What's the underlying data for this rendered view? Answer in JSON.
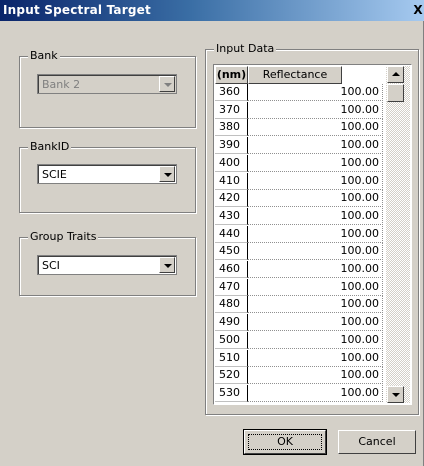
{
  "window": {
    "title": "Input Spectral Target",
    "close_glyph": "X"
  },
  "bank": {
    "legend": "Bank",
    "value": "Bank 2"
  },
  "bankid": {
    "legend": "BankID",
    "value": "SCIE"
  },
  "traits": {
    "legend": "Group Traits",
    "value": "SCI"
  },
  "input_data": {
    "legend": "Input Data",
    "col_nm": "(nm)",
    "col_refl": "Reflectance",
    "rows": [
      {
        "nm": "360",
        "val": "100.00"
      },
      {
        "nm": "370",
        "val": "100.00"
      },
      {
        "nm": "380",
        "val": "100.00"
      },
      {
        "nm": "390",
        "val": "100.00"
      },
      {
        "nm": "400",
        "val": "100.00"
      },
      {
        "nm": "410",
        "val": "100.00"
      },
      {
        "nm": "420",
        "val": "100.00"
      },
      {
        "nm": "430",
        "val": "100.00"
      },
      {
        "nm": "440",
        "val": "100.00"
      },
      {
        "nm": "450",
        "val": "100.00"
      },
      {
        "nm": "460",
        "val": "100.00"
      },
      {
        "nm": "470",
        "val": "100.00"
      },
      {
        "nm": "480",
        "val": "100.00"
      },
      {
        "nm": "490",
        "val": "100.00"
      },
      {
        "nm": "500",
        "val": "100.00"
      },
      {
        "nm": "510",
        "val": "100.00"
      },
      {
        "nm": "520",
        "val": "100.00"
      },
      {
        "nm": "530",
        "val": "100.00"
      }
    ]
  },
  "buttons": {
    "ok": "OK",
    "cancel": "Cancel"
  }
}
